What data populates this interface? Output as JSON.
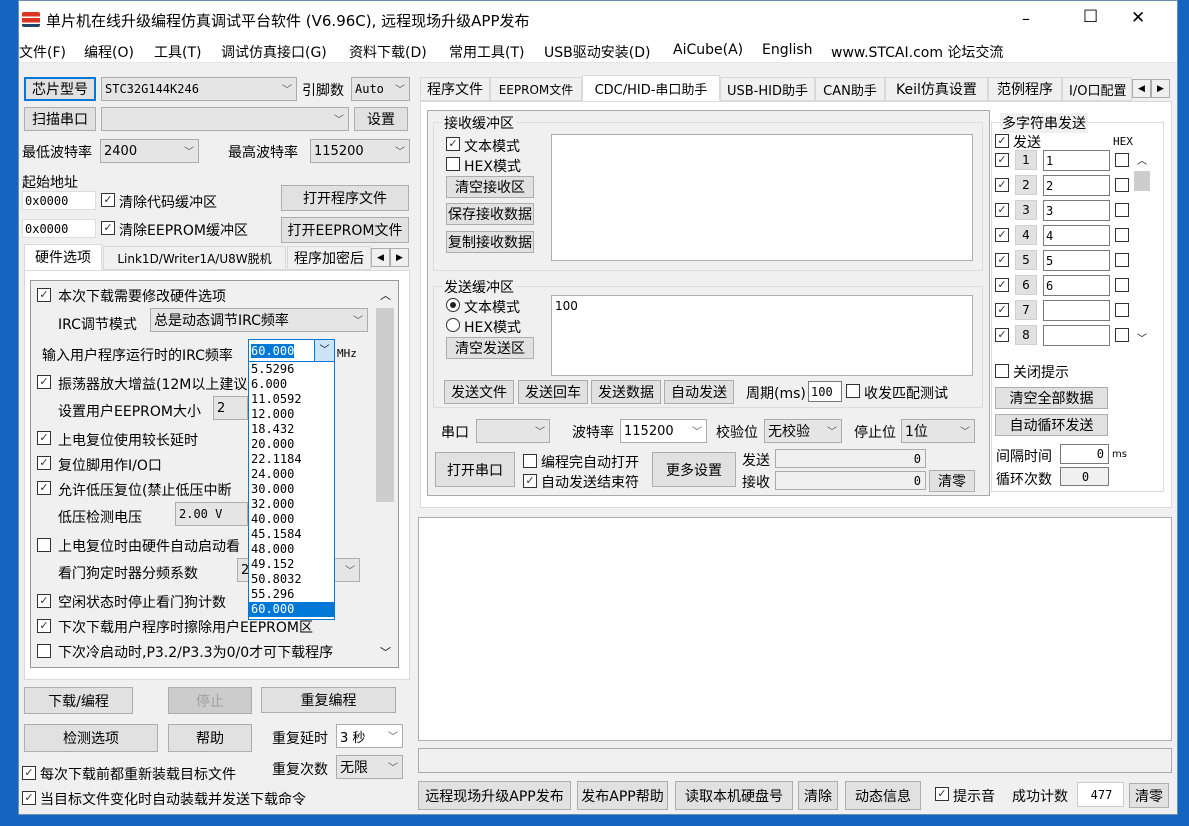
{
  "window": {
    "title": "单片机在线升级编程仿真调试平台软件 (V6.96C), 远程现场升级APP发布",
    "minimize": "–",
    "maximize": "☐",
    "close": "✕"
  },
  "menu": [
    "文件(F)",
    "编程(O)",
    "工具(T)",
    "调试仿真接口(G)",
    "资料下载(D)",
    "常用工具(T)",
    "USB驱动安装(D)",
    "AiCube(A)",
    "English",
    "www.STCAI.com 论坛交流"
  ],
  "left": {
    "chip_button": "芯片型号",
    "chip_value": "STC32G144K246",
    "pins_label": "引脚数",
    "pins_value": "Auto",
    "scan_button": "扫描串口",
    "port_value": "",
    "settings_button": "设置",
    "min_baud_label": "最低波特率",
    "min_baud": "2400",
    "max_baud_label": "最高波特率",
    "max_baud": "115200",
    "start_addr_label": "起始地址",
    "code_addr": "0x0000",
    "eeprom_addr": "0x0000",
    "clear_code": "清除代码缓冲区",
    "clear_eeprom": "清除EEPROM缓冲区",
    "open_prog": "打开程序文件",
    "open_eeprom": "打开EEPROM文件",
    "tabs": [
      "硬件选项",
      "Link1D/Writer1A/U8W脱机",
      "程序加密后"
    ],
    "options": {
      "modify_hw": "本次下载需要修改硬件选项",
      "irc_mode_label": "IRC调节模式",
      "irc_mode": "总是动态调节IRC频率",
      "irc_freq_label": "输入用户程序运行时的IRC频率",
      "irc_freq": "60.000",
      "irc_unit": "MHz",
      "osc_gain": "振荡器放大增益(12M以上建议",
      "eeprom_size_label": "设置用户EEPROM大小",
      "eeprom_size": "2",
      "long_delay": "上电复位使用较长延时",
      "reset_io": "复位脚用作I/O口",
      "lvr": "允许低压复位(禁止低压中断",
      "lvd_label": "低压检测电压",
      "lvd": "2.00 V",
      "wdt_auto": "上电复位时由硬件自动启动看",
      "wdt_div_label": "看门狗定时器分频系数",
      "wdt_div": "2",
      "idle_wdt": "空闲状态时停止看门狗计数",
      "erase_eeprom": "下次下载用户程序时擦除用户EEPROM区",
      "cold_boot": "下次冷启动时,P3.2/P3.3为0/0才可下载程序"
    },
    "freq_options": [
      "5.5296",
      "6.000",
      "11.0592",
      "12.000",
      "18.432",
      "20.000",
      "22.1184",
      "24.000",
      "30.000",
      "32.000",
      "40.000",
      "45.1584",
      "48.000",
      "49.152",
      "50.8032",
      "55.296",
      "60.000"
    ],
    "download": "下载/编程",
    "stop": "停止",
    "repeat": "重复编程",
    "check": "检测选项",
    "help": "帮助",
    "repeat_delay_label": "重复延时",
    "repeat_delay": "3 秒",
    "repeat_count_label": "重复次数",
    "repeat_count": "无限",
    "reload": "每次下载前都重新装载目标文件",
    "autoload": "当目标文件变化时自动装载并发送下载命令"
  },
  "right": {
    "tabs": [
      "程序文件",
      "EEPROM文件",
      "CDC/HID-串口助手",
      "USB-HID助手",
      "CAN助手",
      "Keil仿真设置",
      "范例程序",
      "I/O口配置"
    ],
    "recv": {
      "title": "接收缓冲区",
      "text_mode": "文本模式",
      "hex_mode": "HEX模式",
      "clear": "清空接收区",
      "save": "保存接收数据",
      "copy": "复制接收数据",
      "content": ""
    },
    "send": {
      "title": "发送缓冲区",
      "text_mode": "文本模式",
      "hex_mode": "HEX模式",
      "clear": "清空发送区",
      "content": "100",
      "send_file": "发送文件",
      "send_enter": "发送回车",
      "send_data": "发送数据",
      "auto_send": "自动发送",
      "period_label": "周期(ms)",
      "period": "100",
      "match_test": "收发匹配测试"
    },
    "port_label": "串口",
    "port": "",
    "baud_label": "波特率",
    "baud": "115200",
    "parity_label": "校验位",
    "parity": "无校验",
    "stop_label": "停止位",
    "stopbits": "1位",
    "open_port": "打开串口",
    "auto_open": "编程完自动打开",
    "auto_end": "自动发送结束符",
    "more": "更多设置",
    "tx_label": "发送",
    "tx": "0",
    "rx_label": "接收",
    "rx": "0",
    "clear_count": "清零",
    "multi": {
      "title": "多字符串发送",
      "send": "发送",
      "hex": "HEX",
      "rows": [
        {
          "n": "1",
          "v": "1"
        },
        {
          "n": "2",
          "v": "2"
        },
        {
          "n": "3",
          "v": "3"
        },
        {
          "n": "4",
          "v": "4"
        },
        {
          "n": "5",
          "v": "5"
        },
        {
          "n": "6",
          "v": "6"
        },
        {
          "n": "7",
          "v": ""
        },
        {
          "n": "8",
          "v": ""
        }
      ],
      "close_tip": "关闭提示",
      "clear_all": "清空全部数据",
      "auto_loop": "自动循环发送",
      "interval_label": "间隔时间",
      "interval": "0",
      "interval_unit": "ms",
      "loop_label": "循环次数",
      "loop": "0"
    },
    "output": "",
    "status": "",
    "bottom": {
      "publish": "远程现场升级APP发布",
      "publish_help": "发布APP帮助",
      "read_disk": "读取本机硬盘号",
      "clear": "清除",
      "dynamic": "动态信息",
      "beep": "提示音",
      "success_label": "成功计数",
      "success": "477",
      "reset": "清零"
    }
  }
}
